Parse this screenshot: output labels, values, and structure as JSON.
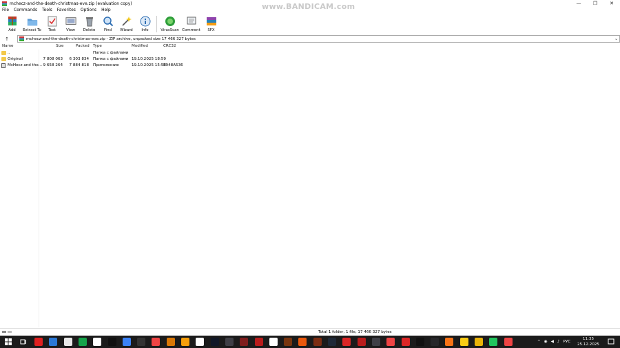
{
  "window": {
    "title": "mchecz-and-the-death-christmas-eve.zip (evaluation copy)",
    "watermark": "www.BANDICAM.com",
    "caption": {
      "minimize": "—",
      "maximize": "❐",
      "close": "✕"
    }
  },
  "menu": [
    "File",
    "Commands",
    "Tools",
    "Favorites",
    "Options",
    "Help"
  ],
  "toolbar": [
    {
      "label": "Add",
      "icon": "add-icon"
    },
    {
      "label": "Extract To",
      "icon": "extract-icon"
    },
    {
      "label": "Test",
      "icon": "test-icon"
    },
    {
      "label": "View",
      "icon": "view-icon"
    },
    {
      "label": "Delete",
      "icon": "delete-icon"
    },
    {
      "label": "Find",
      "icon": "find-icon"
    },
    {
      "label": "Wizard",
      "icon": "wizard-icon"
    },
    {
      "label": "Info",
      "icon": "info-icon"
    },
    {
      "label": "VirusScan",
      "icon": "virusscan-icon"
    },
    {
      "label": "Comment",
      "icon": "comment-icon"
    },
    {
      "label": "SFX",
      "icon": "sfx-icon"
    }
  ],
  "address": {
    "up": "↑",
    "path": "mchecz-and-the-death-christmas-eve.zip - ZIP archive, unpacked size 17 466 327 bytes",
    "dropdown": "⌄"
  },
  "columns": {
    "name": "Name",
    "size": "Size",
    "packed": "Packed",
    "type": "Type",
    "modified": "Modified",
    "crc": "CRC32"
  },
  "files": [
    {
      "name": "..",
      "size": "",
      "packed": "",
      "type": "Папка с файлами",
      "modified": "",
      "crc": "",
      "kind": "folder"
    },
    {
      "name": "Original",
      "size": "7 808 063",
      "packed": "6 303 834",
      "type": "Папка с файлами",
      "modified": "19.10.2025 18:59",
      "crc": "",
      "kind": "folder"
    },
    {
      "name": "McHecz and the...",
      "size": "9 658 264",
      "packed": "7 884 818",
      "type": "Приложение",
      "modified": "19.10.2025 15:58",
      "crc": "E948A536",
      "kind": "file"
    }
  ],
  "status": {
    "text": "Total 1 folder, 1 file, 17 466 327 bytes"
  },
  "taskbar": {
    "lang": "РУС",
    "time": "11:35",
    "date": "25.12.2025",
    "colors": [
      "#e02020",
      "#2b78d6",
      "#e8e8e8",
      "#16a34a",
      "#ffffff",
      "#111111",
      "#3b82f6",
      "#333333",
      "#ef4444",
      "#d97706",
      "#f59e0b",
      "#ffffff",
      "#111827",
      "#3f3f46",
      "#7f1d1d",
      "#b91c1c",
      "#ffffff",
      "#78350f",
      "#ea580c",
      "#7c2d12",
      "#1f2937",
      "#dc2626",
      "#b91c1c",
      "#3f3f46",
      "#ef4444",
      "#dc2626",
      "#111111",
      "#27272a",
      "#f97316",
      "#facc15",
      "#eab308",
      "#22c55e",
      "#ef4444"
    ]
  }
}
